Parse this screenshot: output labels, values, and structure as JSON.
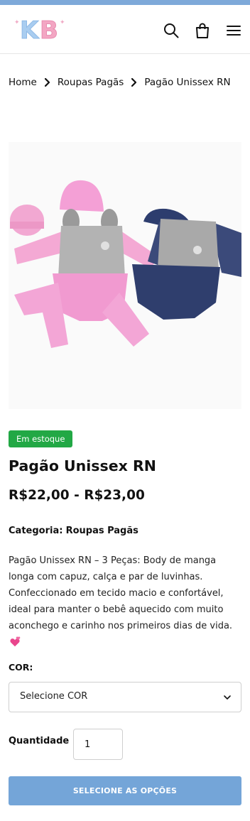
{
  "header": {
    "logo_text": "KB",
    "icons": [
      "search-icon",
      "bag-icon",
      "menu-icon"
    ]
  },
  "breadcrumb": {
    "items": [
      "Home",
      "Roupas Pagãs",
      "Pagão Unissex RN"
    ]
  },
  "product": {
    "stock_badge": "Em estoque",
    "title": "Pagão Unissex RN",
    "price": "R$22,00 - R$23,00",
    "category_label": "Categoria:",
    "category_value": "Roupas Pagãs",
    "description": "Pagão Unissex RN – 3 Peças: Body de manga longa com capuz, calça e par de luvinhas. Confeccionado em tecido macio e confortável, ideal para manter o bebê aquecido com muito aconchego e carinho nos primeiros dias de vida."
  },
  "options": {
    "cor_label": "COR:",
    "cor_selected": "Selecione COR",
    "quantity_label": "Quantidade",
    "quantity_value": "1",
    "submit_label": "SELECIONE AS OPÇÕES"
  },
  "colors": {
    "stripe": "#7ea9d9",
    "badge": "#22a845",
    "button": "#74a5d8"
  }
}
